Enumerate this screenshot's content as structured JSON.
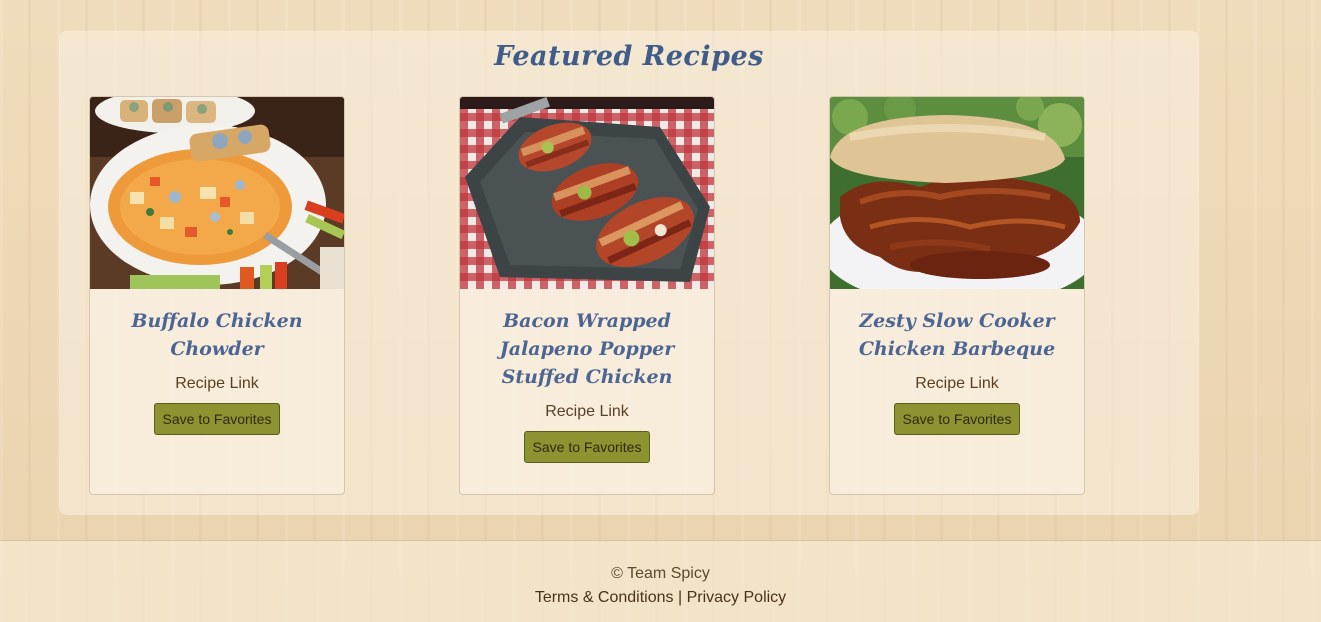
{
  "featured": {
    "title": "Featured Recipes",
    "cards": [
      {
        "title": "Buffalo Chicken Chowder",
        "link_label": "Recipe Link",
        "button_label": "Save to Favorites"
      },
      {
        "title": "Bacon Wrapped Jalapeno Popper Stuffed Chicken",
        "link_label": "Recipe Link",
        "button_label": "Save to Favorites"
      },
      {
        "title": "Zesty Slow Cooker Chicken Barbeque",
        "link_label": "Recipe Link",
        "button_label": "Save to Favorites"
      }
    ]
  },
  "footer": {
    "copyright": "© Team Spicy",
    "terms_label": "Terms & Conditions",
    "separator": "|",
    "privacy_label": "Privacy Policy"
  },
  "colors": {
    "title_blue": "#3f5c8a",
    "button_olive": "#8d9331",
    "link_brown": "#5a3f22"
  }
}
